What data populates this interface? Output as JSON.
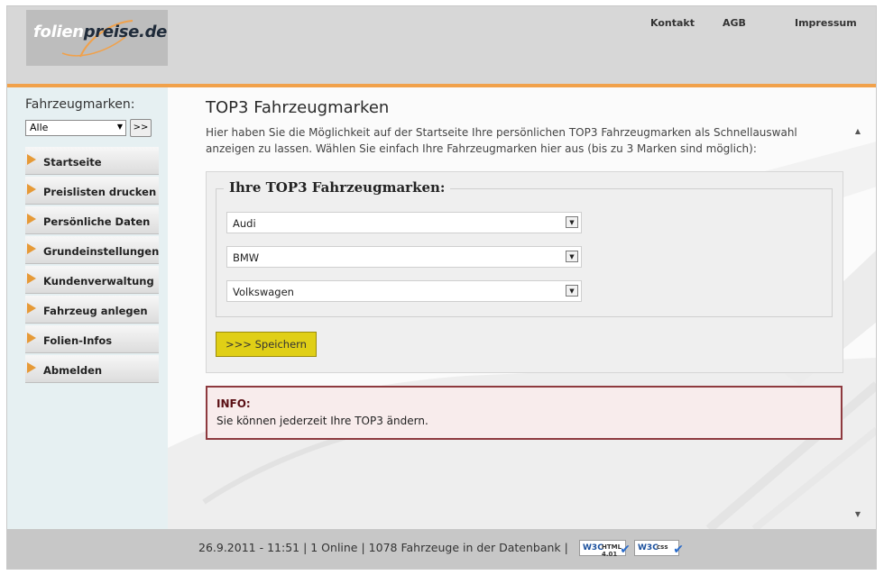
{
  "header": {
    "logo_light": "folien",
    "logo_dark": "preise.de",
    "nav": [
      "Kontakt",
      "AGB",
      "Impressum"
    ]
  },
  "sidebar": {
    "label": "Fahrzeugmarken:",
    "brand_filter_value": "Alle",
    "go_button": ">>",
    "items": [
      {
        "label": "Startseite"
      },
      {
        "label": "Preislisten drucken"
      },
      {
        "label": "Persönliche Daten"
      },
      {
        "label": "Grundeinstellungen"
      },
      {
        "label": "Kundenverwaltung"
      },
      {
        "label": "Fahrzeug anlegen"
      },
      {
        "label": "Folien-Infos"
      },
      {
        "label": "Abmelden"
      }
    ]
  },
  "main": {
    "title": "TOP3 Fahrzeugmarken",
    "intro": "Hier haben Sie die Möglichkeit auf der Startseite Ihre persönlichen TOP3 Fahrzeugmarken als Schnellauswahl anzeigen zu lassen. Wählen Sie einfach Ihre Fahrzeugmarken hier aus (bis zu 3 Marken sind möglich):",
    "form": {
      "legend": "Ihre TOP3 Fahrzeugmarken:",
      "selects": [
        "Audi",
        "BMW",
        "Volkswagen"
      ],
      "save_label": ">>> Speichern"
    },
    "info": {
      "title": "INFO:",
      "text": "Sie können jederzeit Ihre TOP3 ändern."
    }
  },
  "footer": {
    "status": "26.9.2011 - 11:51 | 1 Online | 1078 Fahrzeuge in der Datenbank |",
    "badges": [
      {
        "logo": "W3C",
        "kind": "HTML 4.01"
      },
      {
        "logo": "W3C",
        "kind": "css"
      }
    ]
  },
  "colors": {
    "accent_orange": "#f1a14a",
    "save_button": "#e0cf16",
    "info_border": "#8e3a3f"
  }
}
